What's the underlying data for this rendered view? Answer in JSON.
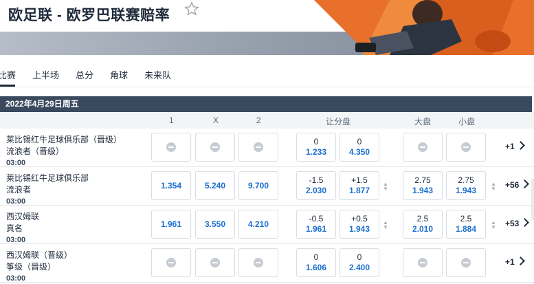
{
  "header": {
    "title": "欧足联 - 欧罗巴联赛赔率"
  },
  "tabs": [
    "比赛",
    "上半场",
    "总分",
    "角球",
    "未来队"
  ],
  "date_label": "2022年4月29日周五",
  "columns": {
    "c1": "1",
    "cx": "X",
    "c2": "2",
    "handicap": "让分盘",
    "over": "大盘",
    "under": "小盘"
  },
  "matches": [
    {
      "home": "莱比锡红牛足球俱乐部（晋级）",
      "away": "流浪者（晋级）",
      "time": "03:00",
      "odds_1": "",
      "odds_x": "",
      "odds_2": "",
      "hcp_home_line": "0",
      "hcp_home_odd": "1.233",
      "hcp_away_line": "0",
      "hcp_away_odd": "4.350",
      "over_line": "",
      "over_odd": "",
      "under_line": "",
      "under_odd": "",
      "more": "+1"
    },
    {
      "home": "莱比锡红牛足球俱乐部",
      "away": "流浪者",
      "time": "03:00",
      "odds_1": "1.354",
      "odds_x": "5.240",
      "odds_2": "9.700",
      "hcp_home_line": "-1.5",
      "hcp_home_odd": "2.030",
      "hcp_away_line": "+1.5",
      "hcp_away_odd": "1.877",
      "over_line": "2.75",
      "over_odd": "1.943",
      "under_line": "2.75",
      "under_odd": "1.943",
      "more": "+56"
    },
    {
      "home": "西汉姆联",
      "away": "真名",
      "time": "03:00",
      "odds_1": "1.961",
      "odds_x": "3.550",
      "odds_2": "4.210",
      "hcp_home_line": "-0.5",
      "hcp_home_odd": "1.961",
      "hcp_away_line": "+0.5",
      "hcp_away_odd": "1.943",
      "over_line": "2.5",
      "over_odd": "2.010",
      "under_line": "2.5",
      "under_odd": "1.884",
      "more": "+53"
    },
    {
      "home": "西汉姆联（晋级）",
      "away": "筝级（晋级）",
      "time": "03:00",
      "odds_1": "",
      "odds_x": "",
      "odds_2": "",
      "hcp_home_line": "0",
      "hcp_home_odd": "1.606",
      "hcp_away_line": "0",
      "hcp_away_odd": "2.400",
      "over_line": "",
      "over_odd": "",
      "under_line": "",
      "under_odd": "",
      "more": "+1"
    }
  ]
}
